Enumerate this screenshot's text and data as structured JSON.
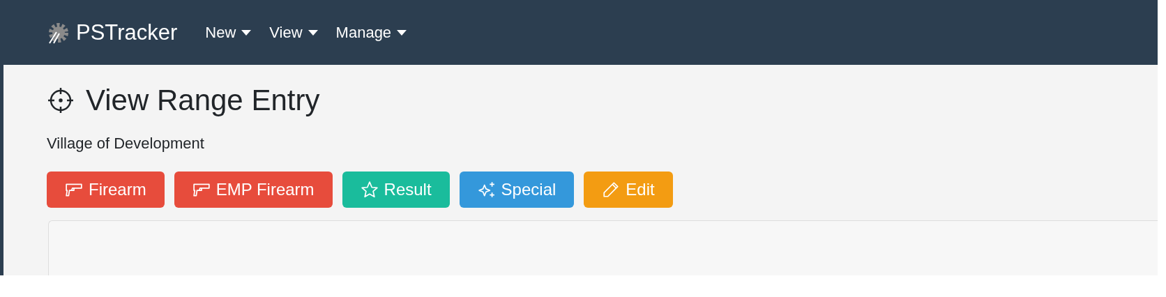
{
  "navbar": {
    "brand": "PSTracker",
    "menus": [
      {
        "label": "New"
      },
      {
        "label": "View"
      },
      {
        "label": "Manage"
      }
    ]
  },
  "page": {
    "title": "View Range Entry",
    "subtitle": "Village of Development"
  },
  "buttons": [
    {
      "label": "Firearm",
      "kind": "gun",
      "color": "#e74c3c"
    },
    {
      "label": "EMP Firearm",
      "kind": "gun",
      "color": "#e74c3c"
    },
    {
      "label": "Result",
      "kind": "star",
      "color": "#1abc9c"
    },
    {
      "label": "Special",
      "kind": "sparkles",
      "color": "#3498db"
    },
    {
      "label": "Edit",
      "kind": "pencil",
      "color": "#f39c12"
    }
  ]
}
